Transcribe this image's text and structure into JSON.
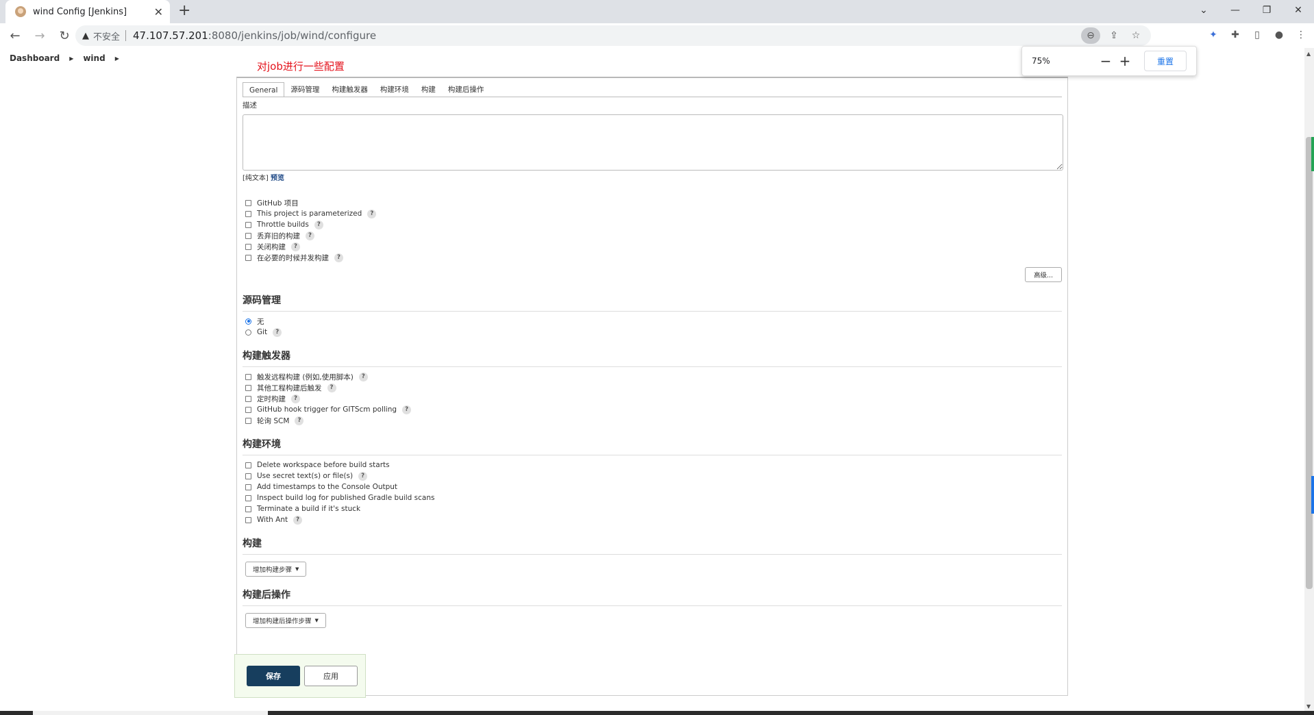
{
  "browser": {
    "tab_title": "wind Config [Jenkins]",
    "tab_close": "✕",
    "new_tab": "+",
    "security_label": "不安全",
    "url_host": "47.107.57.201",
    "url_path": ":8080/jenkins/job/wind/configure",
    "zoom": {
      "percent": "75%",
      "minus": "−",
      "plus": "+",
      "reset": "重置"
    }
  },
  "breadcrumb": {
    "items": [
      "Dashboard",
      "wind"
    ]
  },
  "annotation": "对job进行一些配置",
  "config": {
    "tabs": [
      "General",
      "源码管理",
      "构建触发器",
      "构建环境",
      "构建",
      "构建后操作"
    ],
    "description_label": "描述",
    "plain_text_prefix": "[纯文本]",
    "preview_link": "预览",
    "general_options": [
      {
        "label": "GitHub 项目",
        "help": false
      },
      {
        "label": "This project is parameterized",
        "help": true
      },
      {
        "label": "Throttle builds",
        "help": true
      },
      {
        "label": "丢弃旧的构建",
        "help": true
      },
      {
        "label": "关闭构建",
        "help": true
      },
      {
        "label": "在必要的时候并发构建",
        "help": true
      }
    ],
    "advanced_button": "高级...",
    "scm": {
      "title": "源码管理",
      "options": [
        {
          "label": "无",
          "selected": true,
          "help": false
        },
        {
          "label": "Git",
          "selected": false,
          "help": true
        }
      ]
    },
    "triggers": {
      "title": "构建触发器",
      "options": [
        {
          "label": "触发远程构建 (例如,使用脚本)",
          "help": true
        },
        {
          "label": "其他工程构建后触发",
          "help": true
        },
        {
          "label": "定时构建",
          "help": true
        },
        {
          "label": "GitHub hook trigger for GITScm polling",
          "help": true
        },
        {
          "label": "轮询 SCM",
          "help": true
        }
      ]
    },
    "environment": {
      "title": "构建环境",
      "options": [
        {
          "label": "Delete workspace before build starts",
          "help": false
        },
        {
          "label": "Use secret text(s) or file(s)",
          "help": true
        },
        {
          "label": "Add timestamps to the Console Output",
          "help": false
        },
        {
          "label": "Inspect build log for published Gradle build scans",
          "help": false
        },
        {
          "label": "Terminate a build if it's stuck",
          "help": false
        },
        {
          "label": "With Ant",
          "help": true
        }
      ]
    },
    "build": {
      "title": "构建",
      "add_step": "增加构建步骤"
    },
    "post_build": {
      "title": "构建后操作",
      "add_step": "增加构建后操作步骤"
    }
  },
  "actions": {
    "save": "保存",
    "apply": "应用"
  },
  "help_glyph": "?",
  "colors": {
    "annotation": "#e4121b",
    "save_button": "#173e5e",
    "link": "#204a87"
  }
}
